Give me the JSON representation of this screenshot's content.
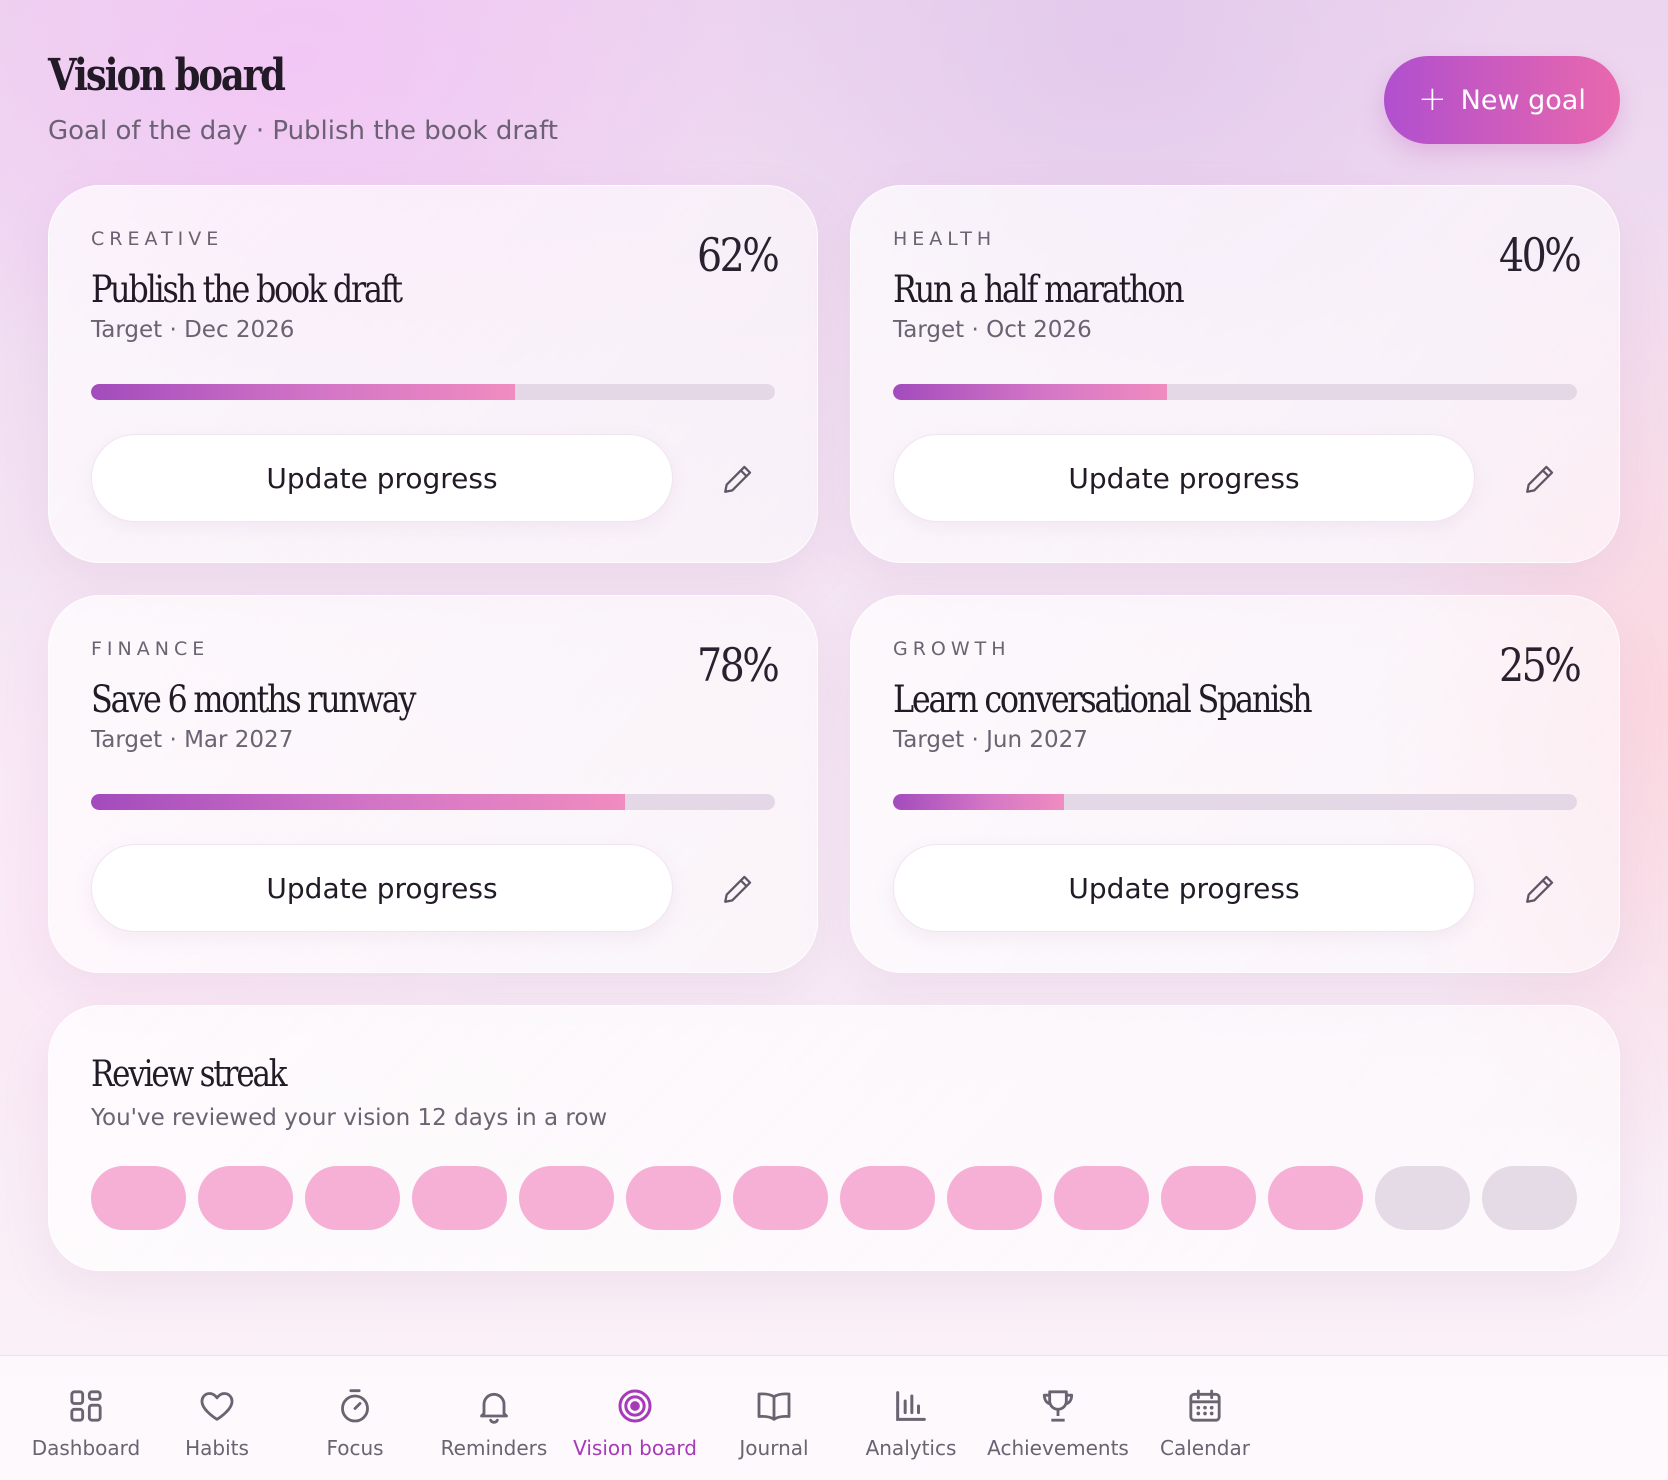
{
  "header": {
    "title": "Vision board",
    "subtitle": "Goal of the day · Publish the book draft",
    "new_goal_label": "New goal"
  },
  "goals": [
    {
      "category": "CREATIVE",
      "title": "Publish the book draft",
      "target": "Target · Dec 2026",
      "percent_label": "62%",
      "progress": 0.62,
      "button": "Update progress"
    },
    {
      "category": "HEALTH",
      "title": "Run a half marathon",
      "target": "Target · Oct 2026",
      "percent_label": "40%",
      "progress": 0.4,
      "button": "Update progress"
    },
    {
      "category": "FINANCE",
      "title": "Save 6 months runway",
      "target": "Target · Mar 2027",
      "percent_label": "78%",
      "progress": 0.78,
      "button": "Update progress"
    },
    {
      "category": "GROWTH",
      "title": "Learn conversational Spanish",
      "target": "Target · Jun 2027",
      "percent_label": "25%",
      "progress": 0.25,
      "button": "Update progress"
    }
  ],
  "streak": {
    "title": "Review streak",
    "subtitle": "You've reviewed your vision 12 days in a row",
    "days": [
      true,
      true,
      true,
      true,
      true,
      true,
      true,
      true,
      true,
      true,
      true,
      true,
      false,
      false
    ]
  },
  "nav": [
    {
      "label": "Dashboard",
      "icon": "dashboard-icon",
      "active": false
    },
    {
      "label": "Habits",
      "icon": "heart-icon",
      "active": false
    },
    {
      "label": "Focus",
      "icon": "timer-icon",
      "active": false
    },
    {
      "label": "Reminders",
      "icon": "bell-icon",
      "active": false
    },
    {
      "label": "Vision board",
      "icon": "target-icon",
      "active": true
    },
    {
      "label": "Journal",
      "icon": "book-icon",
      "active": false
    },
    {
      "label": "Analytics",
      "icon": "bar-chart-icon",
      "active": false
    },
    {
      "label": "Achievements",
      "icon": "trophy-icon",
      "active": false
    },
    {
      "label": "Calendar",
      "icon": "calendar-icon",
      "active": false
    }
  ],
  "colors": {
    "accent": "#a63ab8",
    "gradient_start": "#b04fce",
    "gradient_end": "#e968ad",
    "streak_on": "#f6b0d6",
    "streak_off": "#e5dbe7"
  }
}
